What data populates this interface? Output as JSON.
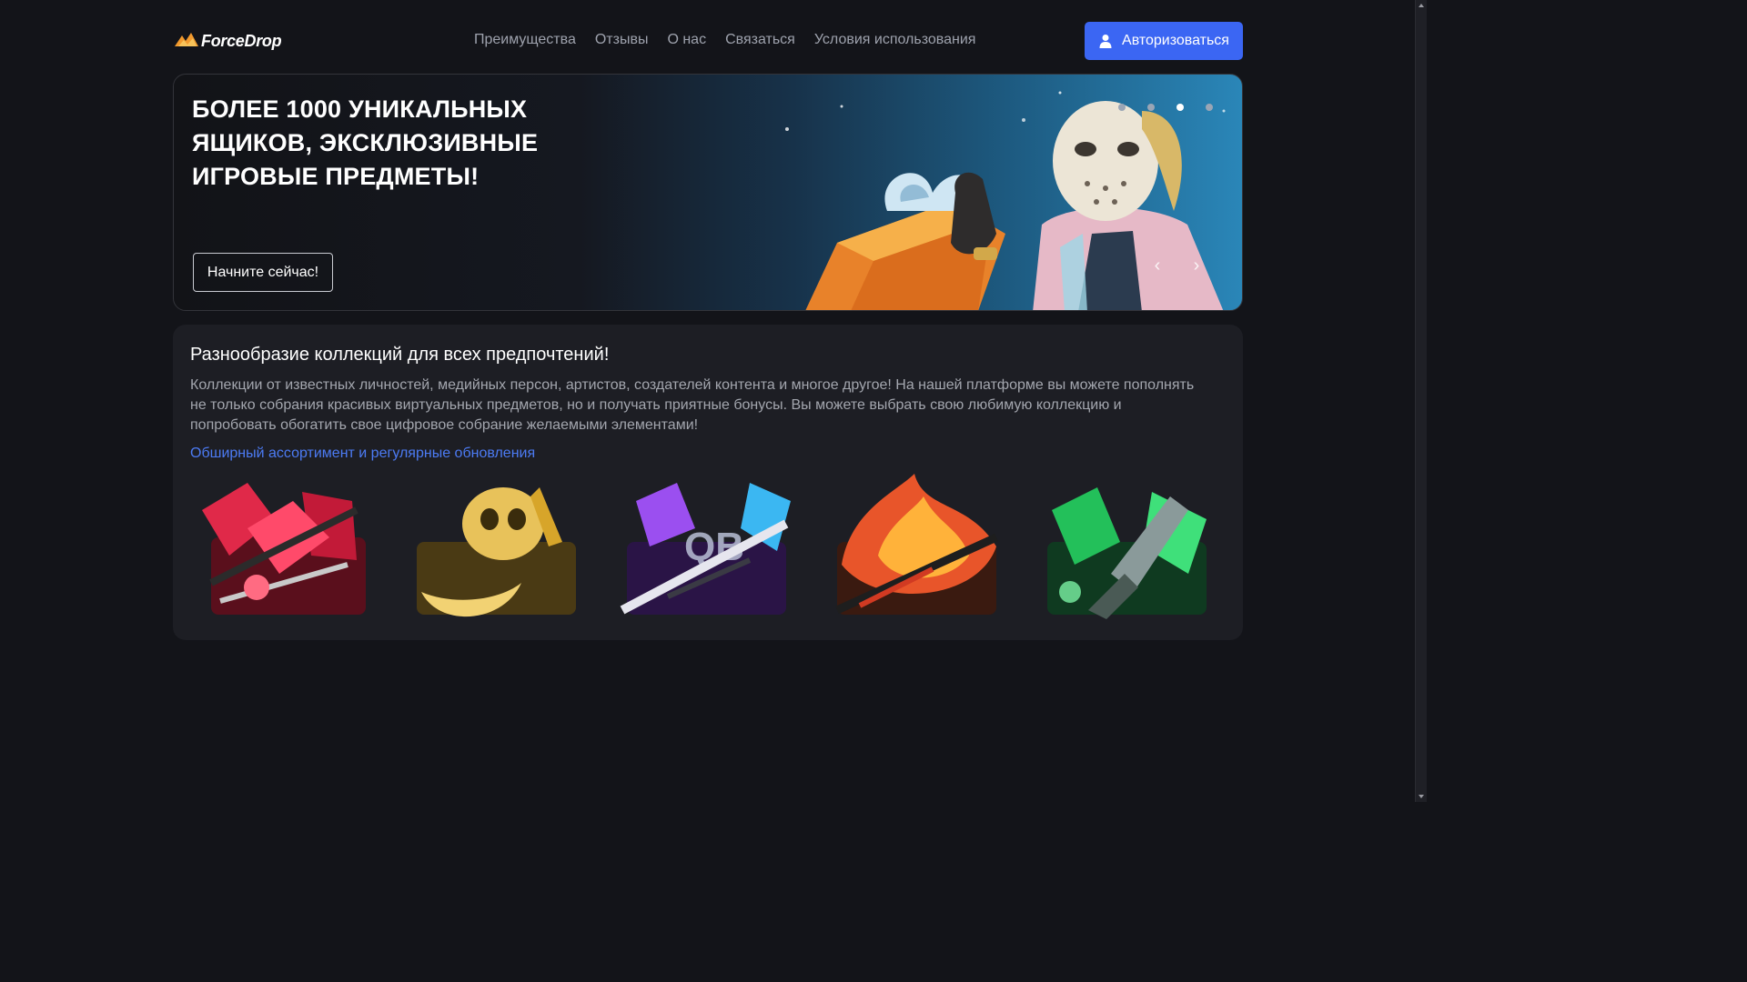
{
  "header": {
    "logo_text": "ForceDrop",
    "nav": [
      "Преимущества",
      "Отзывы",
      "О нас",
      "Связаться",
      "Условия использования"
    ],
    "login_label": "Авторизоваться"
  },
  "banner": {
    "title": "БОЛЕЕ 1000 УНИКАЛЬНЫХ ЯЩИКОВ, ЭКСКЛЮЗИВНЫЕ ИГРОВЫЕ ПРЕДМЕТЫ!",
    "cta_label": "Начните сейчас!",
    "slides_count": 4,
    "active_slide": 3,
    "prev_glyph": "‹",
    "next_glyph": "›"
  },
  "collections": {
    "heading": "Разнообразие коллекций для всех предпочтений!",
    "description": "Коллекции от известных личностей, медийных персон, артистов, создателей контента и многое другое! На нашей платформе вы можете пополнять не только собрания красивых виртуальных предметов, но и получать приятные бонусы. Вы можете выбрать свою любимую коллекцию и попробовать обогатить свое цифровое собрание желаемыми элементами!",
    "link_label": "Обширный ассортимент и регулярные обновления",
    "cases": [
      {
        "name": "red-case",
        "color": "#d4213f"
      },
      {
        "name": "gold-case",
        "color": "#d7a52a"
      },
      {
        "name": "purple-case",
        "color": "#8e3fe0"
      },
      {
        "name": "fire-case",
        "color": "#e8552a"
      },
      {
        "name": "green-case",
        "color": "#23c05a"
      }
    ]
  },
  "colors": {
    "background": "#131419",
    "accent": "#3b66f3",
    "link": "#4c7bf4"
  }
}
